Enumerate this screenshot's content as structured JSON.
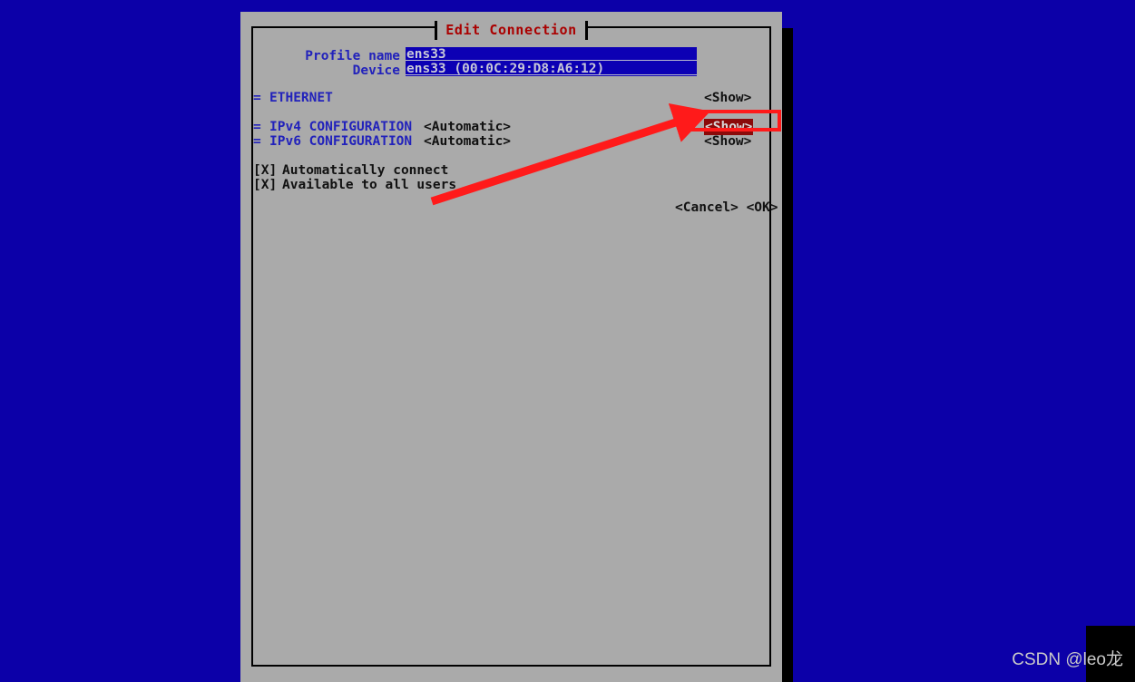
{
  "window": {
    "title": "Edit Connection"
  },
  "form": {
    "profile_name_label": "Profile name",
    "profile_name_value": "ens33",
    "device_label": "Device",
    "device_value": "ens33 (00:0C:29:D8:A6:12)"
  },
  "sections": {
    "ethernet": {
      "prefix": "=",
      "label": "ETHERNET",
      "action": "<Show>"
    },
    "ipv4": {
      "prefix": "=",
      "label": "IPv4 CONFIGURATION",
      "value": "<Automatic>",
      "action": "<Show>"
    },
    "ipv6": {
      "prefix": "=",
      "label": "IPv6 CONFIGURATION",
      "value": "<Automatic>",
      "action": "<Show>"
    }
  },
  "checkboxes": [
    {
      "mark": "[X]",
      "label": "Automatically connect"
    },
    {
      "mark": "[X]",
      "label": "Available to all users"
    }
  ],
  "footer": {
    "buttons": "<Cancel> <OK>"
  },
  "annotation": {
    "highlight_color": "#ff1a1a",
    "target": "<Show>"
  },
  "watermark": {
    "text": "CSDN @leo龙"
  },
  "colors": {
    "desktop": "#0c00a8",
    "panel": "#aaaaaa",
    "title": "#aa0000",
    "label_blue": "#2222bb",
    "field_bg": "#0c00b4",
    "selected_bg": "#8b0a0a",
    "annotation_red": "#ff1a1a"
  }
}
